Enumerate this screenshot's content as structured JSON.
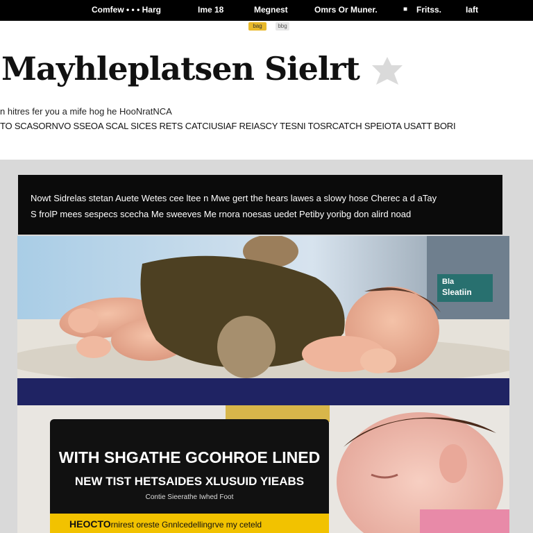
{
  "nav": {
    "items": [
      "Comfew • • • Harg",
      "Ime 18",
      "Megnest",
      "Omrs Or Muner.",
      "Fritss.",
      "Iaft"
    ]
  },
  "badges": [
    "bag",
    "bbg"
  ],
  "article": {
    "headline": "Mayhleplatsen Sielrt",
    "subline": "n hitres fer you a mife hog he HooNratNCA",
    "kicker": "TO SCASORNVO SSEOA SCAL SICES RETS CATCIUSIAF REIASCY TESNI TOSRCATCH SPEIOTA USATT BORI"
  },
  "caption": {
    "line1": "Nowt Sidrelas stetan Auete Wetes cee ltee n Mwe gert the hears lawes a slowy   hose Cherec a d aTay",
    "line2": "S frolP mees sespecs scecha Me sweeves Me rnora noesas uedet Petiby yoribg don alird noad"
  },
  "photo1": {
    "sign_line1": "Bla",
    "sign_line2": "Sleatiin"
  },
  "promo": {
    "headline": "WITH SHGATHE GCOHROE LINED",
    "subheadline": "NEW TIST HETSAIDES XLUSUID YIEABS",
    "small_text": "Contie Sieerathe Iwhed Foot",
    "bar_bold": "HEOCTO",
    "bar_text": "rnirest oreste Gnnlcedellingrve my ceteld"
  }
}
